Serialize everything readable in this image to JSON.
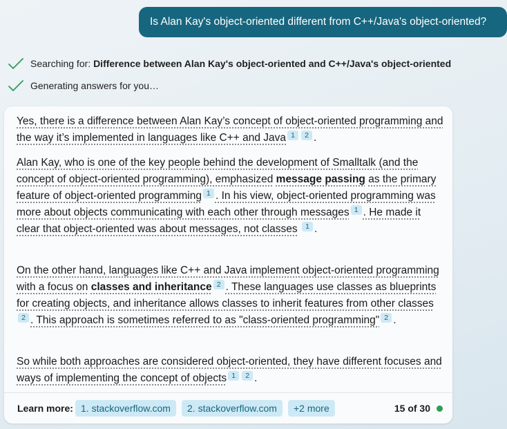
{
  "user_message": "Is Alan Kay's object-oriented different from C++/Java's object-oriented?",
  "status": {
    "searching_label": "Searching for:",
    "searching_query": "Difference between Alan Kay's object-oriented and C++/Java's object-oriented",
    "generating": "Generating answers for you…"
  },
  "answer": {
    "p1": {
      "text": "Yes, there is a difference between Alan Kay’s concept of object-oriented programming and the way it’s implemented in languages like C++ and Java",
      "cites": [
        "1",
        "2"
      ],
      "end": "."
    },
    "p2": {
      "a": "Alan Kay, who is one of the key people behind the development of Smalltalk (and the concept of object-oriented programming), emphasized",
      "bold": "message passing",
      "b": "as the primary feature of object-oriented programming",
      "cite1": "1",
      "c": ". In his view, object-oriented programming was more about objects communicating with each other through messages",
      "cite2": "1",
      "d": ". He made it clear that object-oriented was about messages, not classes",
      "cite3": "1",
      "end": "."
    },
    "p3": {
      "a": "On the other hand, languages like C++ and Java implement object-oriented programming with a focus on",
      "bold": "classes and inheritance",
      "cite1": "2",
      "b": ". These languages use classes as blueprints for creating objects, and inheritance allows classes to inherit features from other classes",
      "cite2": "2",
      "c": ". This approach is sometimes referred to as \"class-oriented programming\"",
      "cite3": "2",
      "end": "."
    },
    "p4": {
      "text": "So while both approaches are considered object-oriented, they have different focuses and ways of implementing the concept of objects",
      "cites": [
        "1",
        "2"
      ],
      "end": "."
    }
  },
  "learn_more": {
    "label": "Learn more:",
    "links": [
      "1. stackoverflow.com",
      "2. stackoverflow.com",
      "+2 more"
    ]
  },
  "counter": "15 of 30",
  "colors": {
    "user_bubble": "#17667f",
    "chip_bg": "#cde9f5",
    "chip_text": "#17667f",
    "check": "#2d9d54",
    "status_dot": "#2d9d54"
  },
  "icons": {
    "status_check": "checkmark-icon"
  }
}
